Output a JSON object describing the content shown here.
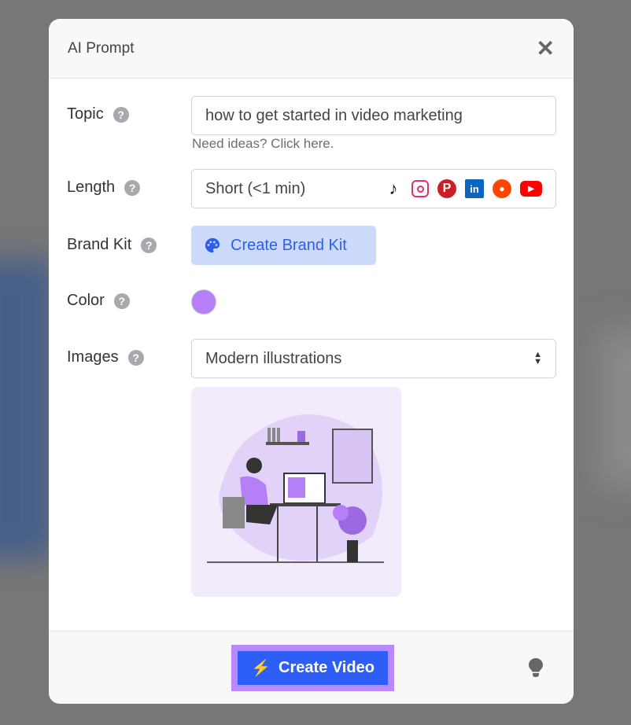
{
  "modal": {
    "title": "AI Prompt",
    "close_icon": "close-icon"
  },
  "fields": {
    "topic": {
      "label": "Topic",
      "value": "how to get started in video marketing",
      "hint": "Need ideas? Click here."
    },
    "length": {
      "label": "Length",
      "value": "Short (<1 min)",
      "platforms": [
        "tiktok",
        "instagram",
        "pinterest",
        "linkedin",
        "reddit",
        "youtube"
      ]
    },
    "brand_kit": {
      "label": "Brand Kit",
      "button": "Create Brand Kit"
    },
    "color": {
      "label": "Color",
      "value": "#b57ff8"
    },
    "images": {
      "label": "Images",
      "value": "Modern illustrations"
    }
  },
  "footer": {
    "create_button": "Create Video"
  },
  "colors": {
    "primary": "#2e5ef8",
    "accent": "#b98afc"
  }
}
